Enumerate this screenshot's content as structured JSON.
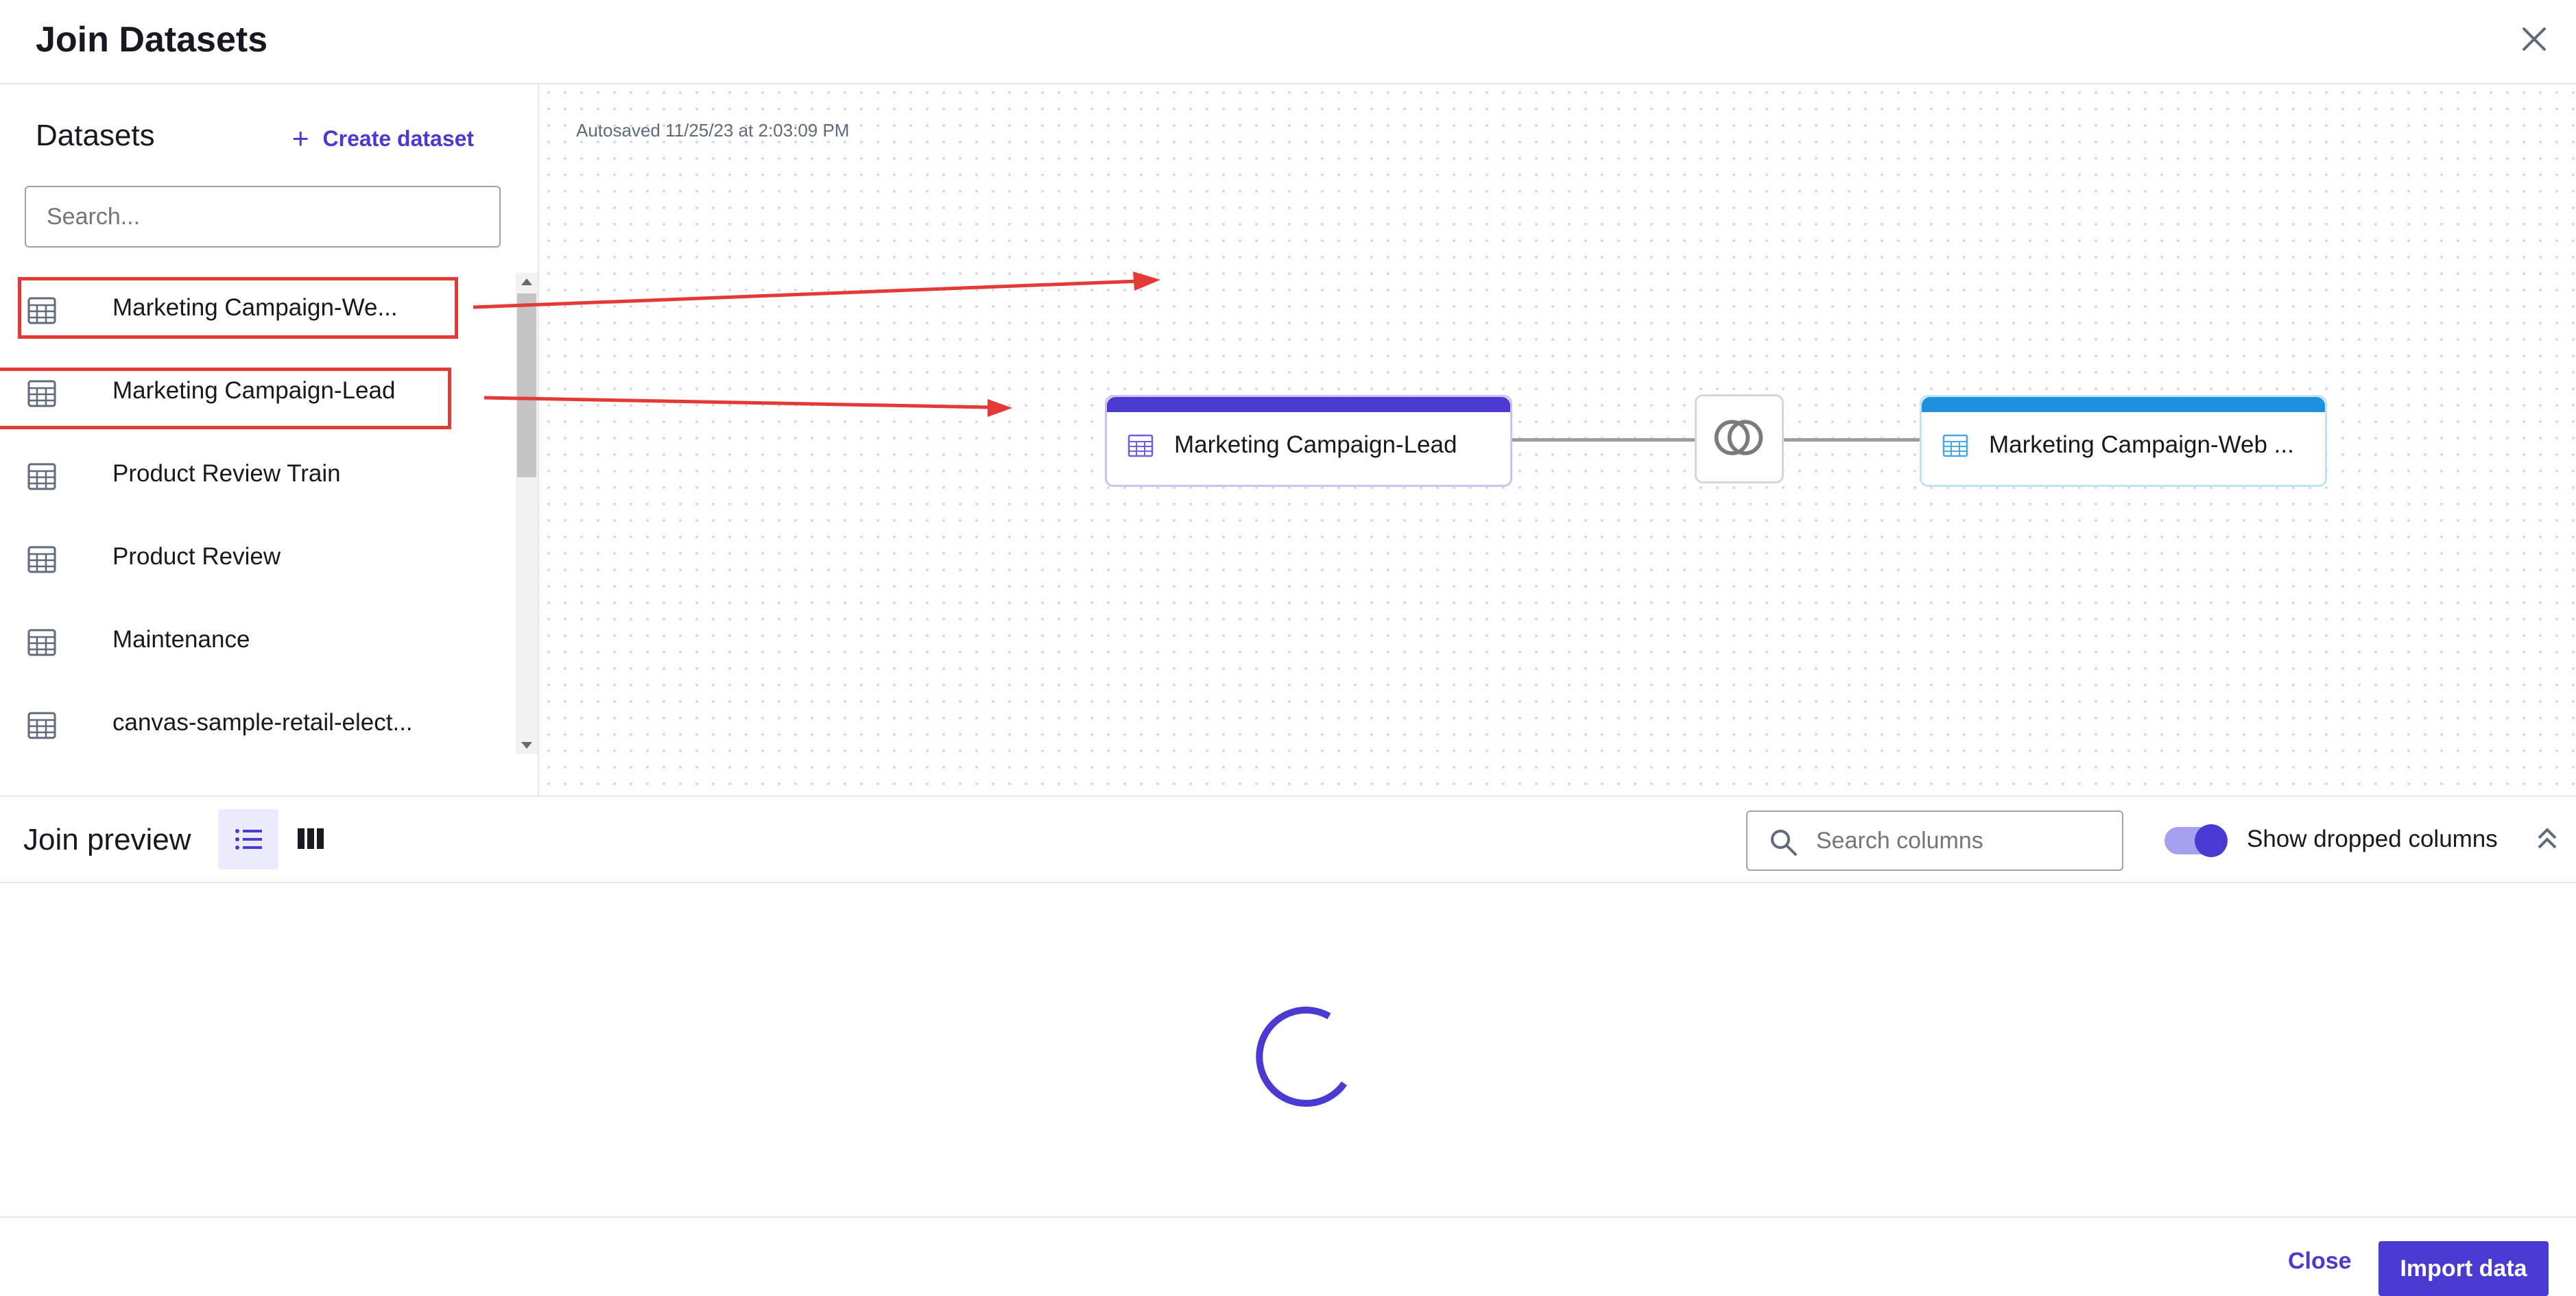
{
  "header": {
    "title": "Join Datasets"
  },
  "sidebar": {
    "title": "Datasets",
    "create_label": "Create dataset",
    "search_placeholder": "Search...",
    "items": [
      {
        "label": "Marketing Campaign-We..."
      },
      {
        "label": "Marketing Campaign-Lead"
      },
      {
        "label": "Product Review Train"
      },
      {
        "label": "Product Review"
      },
      {
        "label": "Maintenance"
      },
      {
        "label": "canvas-sample-retail-elect..."
      }
    ]
  },
  "canvas": {
    "autosave": "Autosaved 11/25/23 at 2:03:09 PM",
    "left_node": "Marketing Campaign-Lead",
    "right_node": "Marketing Campaign-Web ...",
    "join_icon": "inner-join-icon"
  },
  "preview": {
    "title": "Join preview",
    "search_placeholder": "Search columns",
    "toggle_label": "Show dropped columns",
    "toggle_on": true
  },
  "footer": {
    "close_label": "Close",
    "import_label": "Import data"
  },
  "colors": {
    "accent": "#4a3ad1",
    "right_node": "#1f8fe0",
    "annotation": "#e53935"
  }
}
